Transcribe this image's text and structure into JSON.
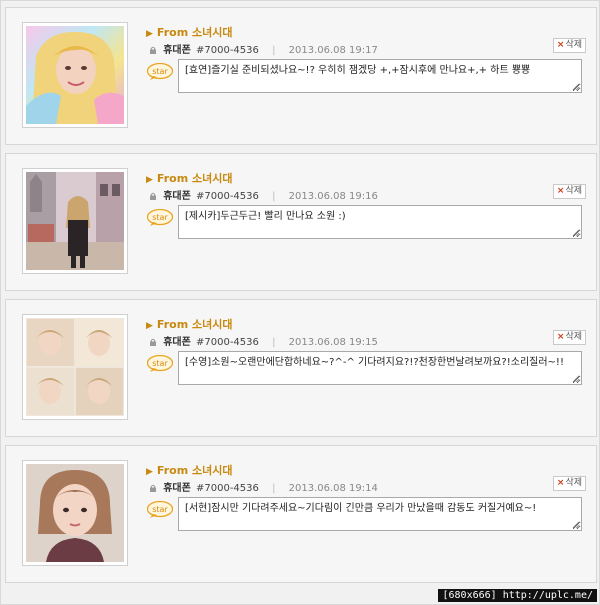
{
  "messages": [
    {
      "from_prefix": "From",
      "from_name": "소녀시대",
      "sender": "휴대폰",
      "number": "#7000-4536",
      "date": "2013.06.08 19:17",
      "delete_label": "삭제",
      "badge": "star",
      "text": "[효연]즐기실 준비되셨나요~!? 우히히 잼겠당 +,+잠시후에 만나요+,+ 하트 뿅뿅",
      "photo_icon": "person-photo"
    },
    {
      "from_prefix": "From",
      "from_name": "소녀시대",
      "sender": "휴대폰",
      "number": "#7000-4536",
      "date": "2013.06.08 19:16",
      "delete_label": "삭제",
      "badge": "star",
      "text": "[제시카]두근두근! 빨리 만나요 소원 :)",
      "photo_icon": "person-photo"
    },
    {
      "from_prefix": "From",
      "from_name": "소녀시대",
      "sender": "휴대폰",
      "number": "#7000-4536",
      "date": "2013.06.08 19:15",
      "delete_label": "삭제",
      "badge": "star",
      "text": "[수영]소원~오랜만에단합하네요~?^-^ 기다려지요?!?천장한번날려보까요?!소리질러~!!",
      "photo_icon": "collage-photo"
    },
    {
      "from_prefix": "From",
      "from_name": "소녀시대",
      "sender": "휴대폰",
      "number": "#7000-4536",
      "date": "2013.06.08 19:14",
      "delete_label": "삭제",
      "badge": "star",
      "text": "[서현]잠시만 기다려주세요~기다림이 긴만큼 우리가 만났을때 감동도 커질거예요~!",
      "photo_icon": "person-photo"
    }
  ],
  "watermark": "[680x666] http://uplc.me/",
  "colors": {
    "accent": "#c8890f",
    "delete_x": "#d03a10",
    "badge": "#e9a21c"
  }
}
